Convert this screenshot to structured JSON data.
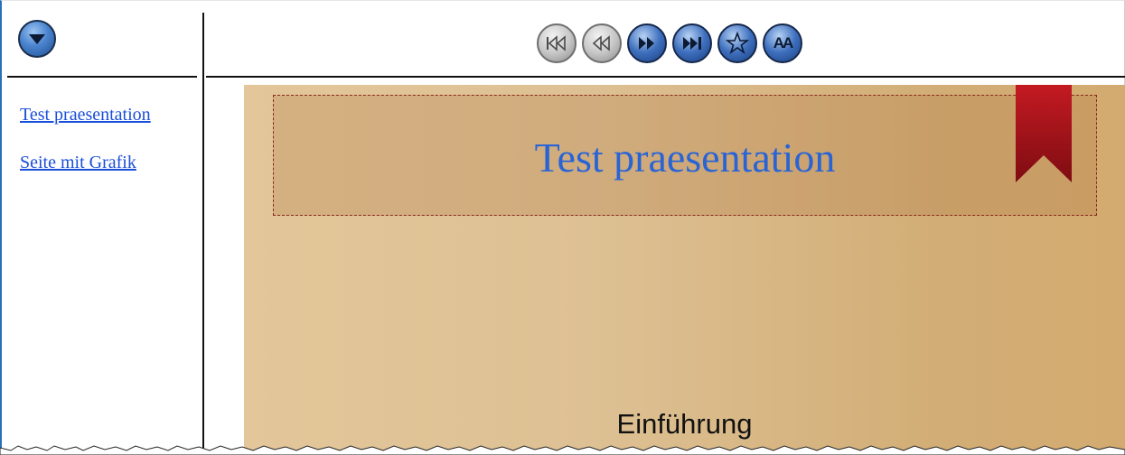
{
  "toolbar": {
    "menu_icon": "chevron-down-icon",
    "buttons": [
      {
        "name": "first-slide-button",
        "icon": "skip-first-icon",
        "state": "disabled"
      },
      {
        "name": "previous-slide-button",
        "icon": "rewind-icon",
        "state": "disabled"
      },
      {
        "name": "next-slide-button",
        "icon": "fast-forward-icon",
        "state": "enabled"
      },
      {
        "name": "last-slide-button",
        "icon": "skip-last-icon",
        "state": "enabled"
      },
      {
        "name": "favorite-button",
        "icon": "star-icon",
        "state": "enabled"
      },
      {
        "name": "font-size-button",
        "icon": "font-size-icon",
        "state": "enabled",
        "label": "AA"
      }
    ]
  },
  "sidebar": {
    "items": [
      {
        "label": "Test praesentation"
      },
      {
        "label": "Seite mit Grafik"
      }
    ]
  },
  "slide": {
    "title": "Test praesentation",
    "subtitle": "Einführung"
  },
  "colors": {
    "accent_blue": "#2864d6",
    "link_blue": "#1a4fd8",
    "slide_bg": "#dfc393",
    "ribbon_red": "#b0151c"
  }
}
